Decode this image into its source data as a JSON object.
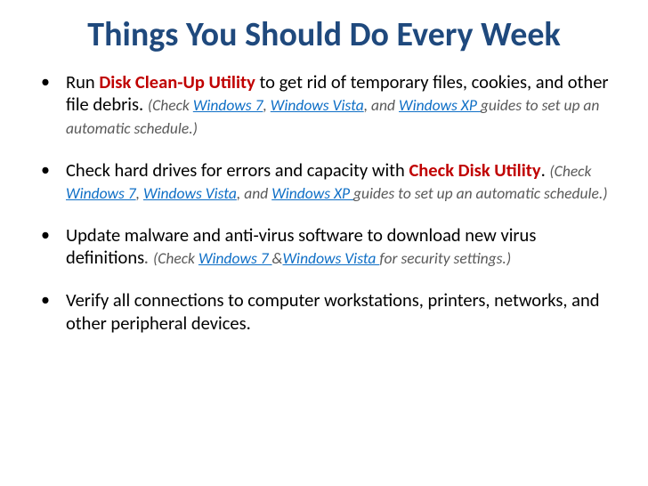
{
  "title": "Things You Should Do Every Week",
  "items": {
    "i1": {
      "t1": "Run ",
      "emph": "Disk Clean-Up Utility",
      "t2": " to get rid of temporary files, cookies, and other file debris. ",
      "note_a": "(Check ",
      "link1": "Windows 7",
      "sep1": ", ",
      "link2": "Windows Vista",
      "sep2": ", and ",
      "link3": "Windows XP ",
      "note_b": "guides to set up an automatic schedule.)"
    },
    "i2": {
      "t1": "Check hard drives for errors and capacity with ",
      "emph": "Check Disk Utility",
      "t2": ". ",
      "note_a": "(Check ",
      "link1": "Windows 7",
      "sep1": ", ",
      "link2": "Windows Vista",
      "sep2": ", and ",
      "link3": "Windows XP ",
      "note_b": "guides to set up an automatic schedule.)"
    },
    "i3": {
      "t1": "Update malware and anti-virus software to download new virus definitions",
      "t2": ". ",
      "note_a": "(Check ",
      "link1": "Windows 7 ",
      "sep1": "&",
      "link2": "Windows Vista ",
      "note_b": "for security settings.)"
    },
    "i4": {
      "t1": "Verify all connections to computer workstations, printers, networks, and other peripheral devices."
    }
  }
}
